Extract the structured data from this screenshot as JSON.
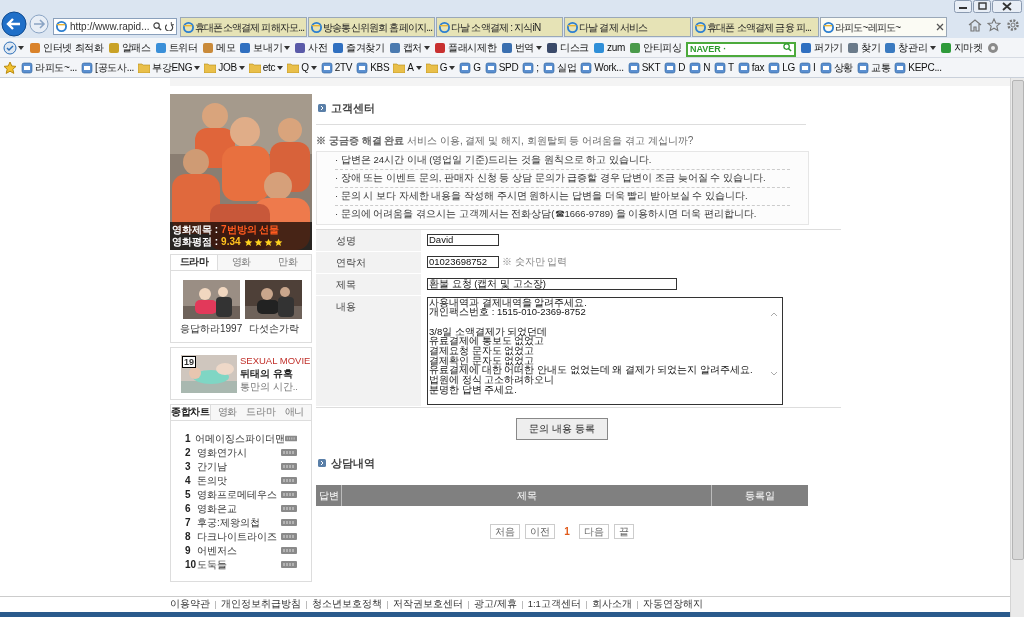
{
  "browser": {
    "address": "http://www.rapid...",
    "tabs": [
      {
        "title": "휴대폰소액결제 피해자모...",
        "selected": false
      },
      {
        "title": "방송통신위원회 홈페이지...",
        "selected": false
      },
      {
        "title": "다날 소액결제 : 지식iN",
        "selected": false
      },
      {
        "title": "다날 결제 서비스",
        "selected": false
      },
      {
        "title": "휴대폰 소액결제 금융 피...",
        "selected": false
      },
      {
        "title": "라피도~레피도~",
        "selected": true
      }
    ],
    "toolbar": [
      {
        "label": "인터넷 최적화",
        "dropdown": false,
        "color": "#d9822b"
      },
      {
        "label": "알패스",
        "dropdown": false,
        "color": "#c9a227"
      },
      {
        "label": "트위터",
        "dropdown": false,
        "color": "#3a8fd8"
      },
      {
        "label": "메모",
        "dropdown": false,
        "color": "#c98a3a"
      },
      {
        "label": "보내기",
        "dropdown": true,
        "color": "#2f6fc0"
      },
      {
        "label": "사전",
        "dropdown": false,
        "color": "#5a5aa8"
      },
      {
        "label": "즐겨찾기",
        "dropdown": false,
        "color": "#2f6fc0"
      },
      {
        "label": "캡처",
        "dropdown": true,
        "color": "#4a7ab0"
      },
      {
        "label": "플래시제한",
        "dropdown": false,
        "color": "#c83030"
      },
      {
        "label": "번역",
        "dropdown": true,
        "color": "#3a6fb0"
      },
      {
        "label": "디스크",
        "dropdown": false,
        "color": "#3a4a6a"
      },
      {
        "label": "zum",
        "dropdown": false,
        "color": "#2f8fd8"
      },
      {
        "label": "안티피싱",
        "dropdown": false,
        "color": "#4a9a4a"
      }
    ],
    "search": {
      "placeholder": "NAVER ·"
    },
    "toolbar_right": [
      {
        "label": "퍼가기",
        "dropdown": false,
        "color": "#2f6fc0"
      },
      {
        "label": "찾기",
        "dropdown": false,
        "color": "#6a7a8a"
      },
      {
        "label": "창관리",
        "dropdown": true,
        "color": "#3a7ac0"
      },
      {
        "label": "지마켓",
        "dropdown": false,
        "color": "#2e9a3a"
      }
    ],
    "favorites": [
      {
        "label": "라피도~...",
        "kind": "page",
        "dropdown": false
      },
      {
        "label": "[공도사...",
        "kind": "page",
        "dropdown": false
      },
      {
        "label": "부강ENG",
        "kind": "folder",
        "dropdown": true
      },
      {
        "label": "JOB",
        "kind": "folder",
        "dropdown": true
      },
      {
        "label": "etc",
        "kind": "folder",
        "dropdown": true
      },
      {
        "label": "Q",
        "kind": "folder",
        "dropdown": true
      },
      {
        "label": "2TV",
        "kind": "page",
        "dropdown": false
      },
      {
        "label": "KBS",
        "kind": "page",
        "dropdown": false
      },
      {
        "label": "A",
        "kind": "folder",
        "dropdown": true
      },
      {
        "label": "G",
        "kind": "folder",
        "dropdown": true
      },
      {
        "label": "G",
        "kind": "page",
        "dropdown": false
      },
      {
        "label": "SPD",
        "kind": "page",
        "dropdown": false
      },
      {
        "label": ";",
        "kind": "page",
        "dropdown": false
      },
      {
        "label": "실업",
        "kind": "page",
        "dropdown": false
      },
      {
        "label": "Work...",
        "kind": "page",
        "dropdown": false
      },
      {
        "label": "SKT",
        "kind": "page",
        "dropdown": false
      },
      {
        "label": "D",
        "kind": "page",
        "dropdown": false
      },
      {
        "label": "N",
        "kind": "page",
        "dropdown": false
      },
      {
        "label": "T",
        "kind": "page",
        "dropdown": false
      },
      {
        "label": "fax",
        "kind": "page",
        "dropdown": false
      },
      {
        "label": "LG",
        "kind": "page",
        "dropdown": false
      },
      {
        "label": "I",
        "kind": "page",
        "dropdown": false
      },
      {
        "label": "상황",
        "kind": "page",
        "dropdown": false
      },
      {
        "label": "교통",
        "kind": "page",
        "dropdown": false
      },
      {
        "label": "KEPC...",
        "kind": "page",
        "dropdown": false
      }
    ]
  },
  "sidebar": {
    "poster": {
      "title_label": "영화제목 :",
      "title": "7번방의 선물",
      "rating_label": "영화평점 :",
      "rating": "9.34",
      "stars": 4
    },
    "media_tabs": [
      {
        "label": "드라마",
        "selected": true
      },
      {
        "label": "영화",
        "selected": false
      },
      {
        "label": "만화",
        "selected": false
      }
    ],
    "thumbnails": [
      {
        "caption": "응답하라1997"
      },
      {
        "caption": "다섯손가락"
      }
    ],
    "ad": {
      "badge": "19",
      "tag": "SEXUAL MOVIE",
      "title": "뒤태의 유혹",
      "subtitle": "통만의 시간.."
    },
    "chart_tabs": [
      {
        "label": "종합차트",
        "selected": true
      },
      {
        "label": "영화",
        "selected": false
      },
      {
        "label": "드라마",
        "selected": false
      },
      {
        "label": "애니",
        "selected": false
      }
    ],
    "chart": [
      {
        "rank": "1",
        "title": "어메이징스파이더맨"
      },
      {
        "rank": "2",
        "title": "영화연가시"
      },
      {
        "rank": "3",
        "title": "간기남"
      },
      {
        "rank": "4",
        "title": "돈의맛"
      },
      {
        "rank": "5",
        "title": "영화프로메테우스"
      },
      {
        "rank": "6",
        "title": "영화은교"
      },
      {
        "rank": "7",
        "title": "후궁:제왕의첩"
      },
      {
        "rank": "8",
        "title": "다크나이트라이즈"
      },
      {
        "rank": "9",
        "title": "어벤저스"
      },
      {
        "rank": "10",
        "title": "도둑들"
      }
    ]
  },
  "main": {
    "section_title": "고객센터",
    "notice": "**※ 궁금증 해결 완료** 서비스 이용, 결제 및 해지, 회원탈퇴 등 어려움을 겪고 계십니까?",
    "guides": [
      "· 답변은 24시간 이내 (영업일 기준)드리는 것을 원칙으로 하고 있습니다.",
      "· 장애 또는 이벤트 문의, 판매자 신청 등 상담 문의가 급증할 경우 답변이 조금 늦어질 수 있습니다.",
      "· 문의 시 보다 자세한 내용을 작성해 주시면 원하시는 답변을 더욱 빨리 받아보실 수 있습니다.",
      "· 문의에 어려움을 겪으시는 고객께서는 전화상담(☎1666-9789) 을 이용하시면 더욱 편리합니다."
    ],
    "fields": [
      {
        "label": "성명",
        "value": "David",
        "kind": "short"
      },
      {
        "label": "연락처",
        "value": "01023698752",
        "kind": "short",
        "hint": "※ 숫자만 입력"
      },
      {
        "label": "제목",
        "value": "환불 요청 (캡처 및 고소장)",
        "kind": "long"
      },
      {
        "label": "내용",
        "value": "사용내역과 결제내역을 알려주세요.\n개인팩스번호 : 1515-010-2369-8752\n\n3/8일 소액결제가 되었던데\n유료결제에 통보도 없었고\n결제요청 문자도 없었고\n결제확인 문자도 없었고\n유료결제에 대한 어떠한 안내도 없었는데 왜 결제가 되었는지 알려주세요.\n법원에 정식 고소하려하오니\n분명한 답변 주세요.",
        "kind": "textarea"
      }
    ],
    "submit": "문의 내용 등록",
    "history_title": "상담내역",
    "table": {
      "columns": [
        "답변",
        "제목",
        "등록일"
      ]
    },
    "pagination": [
      {
        "label": "처음",
        "selected": false,
        "kind": "first"
      },
      {
        "label": "이전",
        "selected": false,
        "kind": "prev"
      },
      {
        "label": "1",
        "selected": true,
        "kind": "page"
      },
      {
        "label": "다음",
        "selected": false,
        "kind": "next"
      },
      {
        "label": "끝",
        "selected": false,
        "kind": "last"
      }
    ]
  },
  "footer": {
    "links": [
      "이용약관",
      "개인정보취급방침",
      "청소년보호정책",
      "저작권보호센터",
      "광고/제휴",
      "1:1고객센터",
      "회사소개",
      "자동연장해지"
    ]
  }
}
